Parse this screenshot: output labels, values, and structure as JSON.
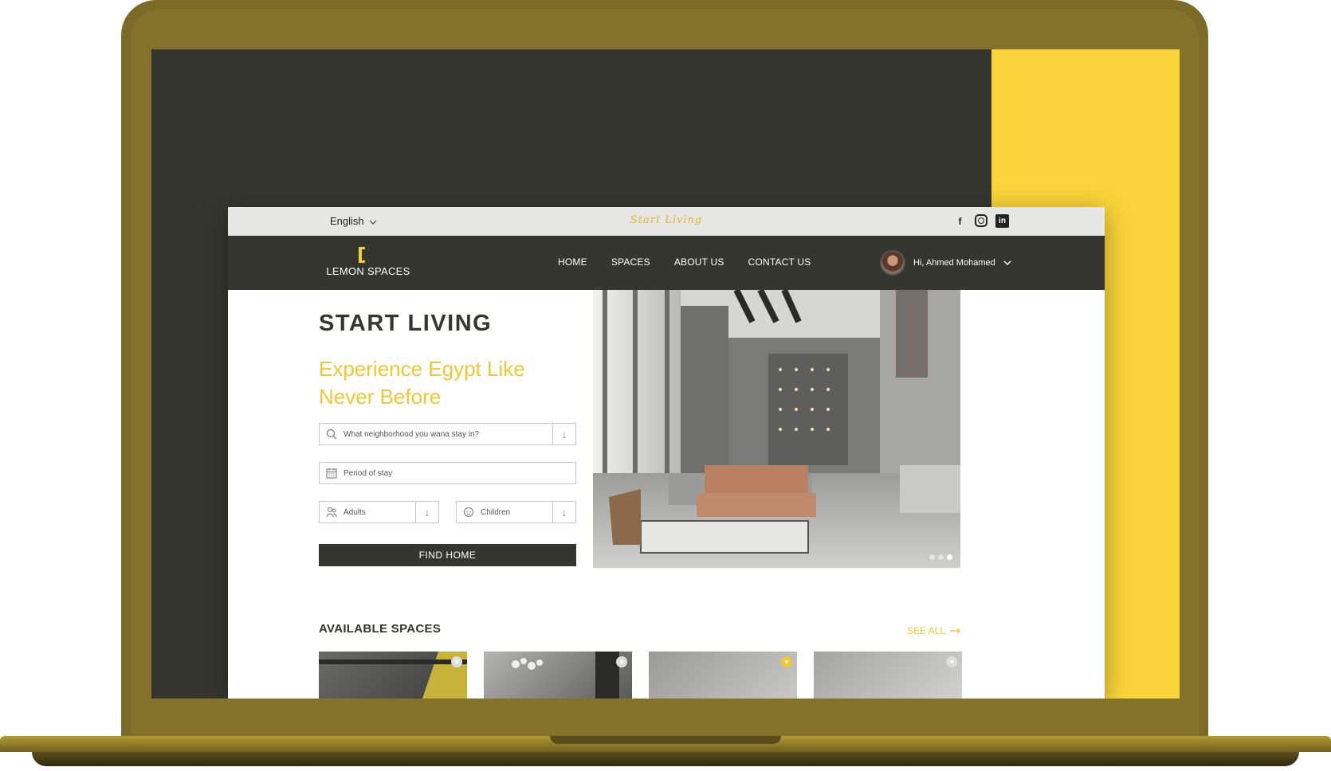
{
  "topbar": {
    "language": "English",
    "tagline": "Start Living",
    "socials": [
      "f",
      "ig",
      "in"
    ]
  },
  "navbar": {
    "logo": "LEMON SPACES",
    "links": [
      "HOME",
      "SPACES",
      "ABOUT US",
      "CONTACT US"
    ],
    "user_greeting": "Hi, Ahmed Mohamed"
  },
  "hero": {
    "title": "START LIVING",
    "subtitle": "Experience Egypt Like Never Before",
    "search_placeholder": "What neighborhood you wana stay in?",
    "period_placeholder": "Period of stay",
    "adults_placeholder": "Adults",
    "children_placeholder": "Children",
    "find_button": "FIND HOME",
    "carousel": {
      "slides": 3,
      "active": 3
    }
  },
  "spaces": {
    "heading": "AVAILABLE SPACES",
    "see_all": "SEE ALL",
    "cards": [
      {
        "favorited": false
      },
      {
        "favorited": false
      },
      {
        "favorited": true
      },
      {
        "favorited": false
      }
    ]
  },
  "colors": {
    "brand_yellow": "#f2c832",
    "dark": "#34362f",
    "laptop_gold": "#84722b"
  }
}
